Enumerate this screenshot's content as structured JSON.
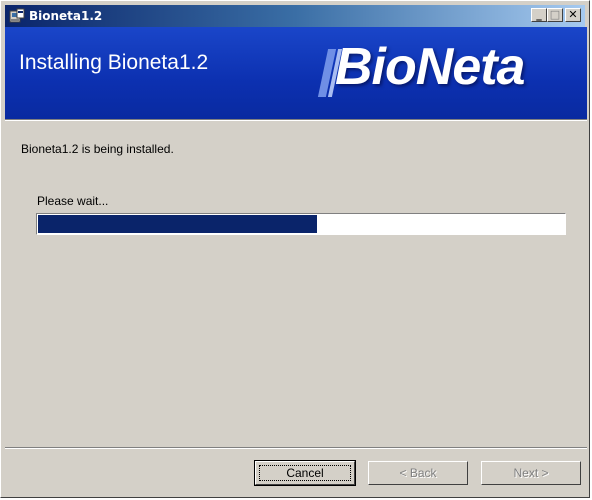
{
  "window": {
    "title": "Bioneta1.2",
    "controls": {
      "minimize": "_",
      "maximize": "□",
      "close": "✕"
    }
  },
  "banner": {
    "heading": "Installing Bioneta1.2",
    "logo": "BioNeta"
  },
  "body": {
    "status": "Bioneta1.2 is being installed.",
    "wait_label": "Please wait...",
    "progress": 0.53
  },
  "buttons": {
    "cancel": "Cancel",
    "back": "< Back",
    "next": "Next >"
  },
  "colors": {
    "banner": "#0c30b0",
    "progress_fill": "#0a246a",
    "dialog_bg": "#d4d0c8"
  }
}
